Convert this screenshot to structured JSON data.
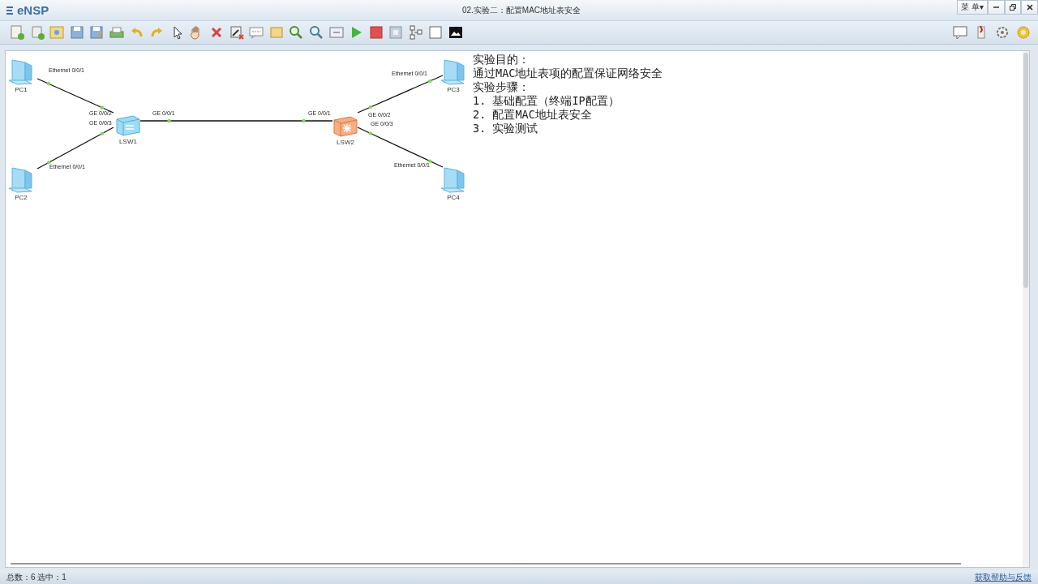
{
  "window": {
    "app_name": "eNSP",
    "title": "02.实验二：配置MAC地址表安全",
    "menu_button": "菜 单▾"
  },
  "topology": {
    "devices": [
      {
        "label": "PC1",
        "kind": "pc"
      },
      {
        "label": "PC2",
        "kind": "pc"
      },
      {
        "label": "LSW1",
        "kind": "switch"
      },
      {
        "label": "LSW2",
        "kind": "core_switch"
      },
      {
        "label": "PC3",
        "kind": "pc"
      },
      {
        "label": "PC4",
        "kind": "pc"
      }
    ],
    "links": [
      {
        "ports": [
          "Ethernet 0/0/1",
          "GE 0/0/2"
        ]
      },
      {
        "ports": [
          "Ethernet 0/0/1",
          "GE 0/0/3"
        ]
      },
      {
        "ports": [
          "GE 0/0/1",
          "GE 0/0/1"
        ]
      },
      {
        "ports": [
          "GE 0/0/2",
          "Ethernet 0/0/1"
        ]
      },
      {
        "ports": [
          "GE 0/0/3",
          "Ethernet 0/0/1"
        ]
      }
    ],
    "note": {
      "lines": [
        "实验目的：",
        "通过MAC地址表项的配置保证网络安全",
        "实验步骤：",
        "1. 基础配置（终端IP配置）",
        "2. 配置MAC地址表安全",
        "3. 实验测试"
      ]
    }
  },
  "status_bar": {
    "summary": "总数：6 选中：1",
    "help_link": "获取帮助与反馈"
  }
}
